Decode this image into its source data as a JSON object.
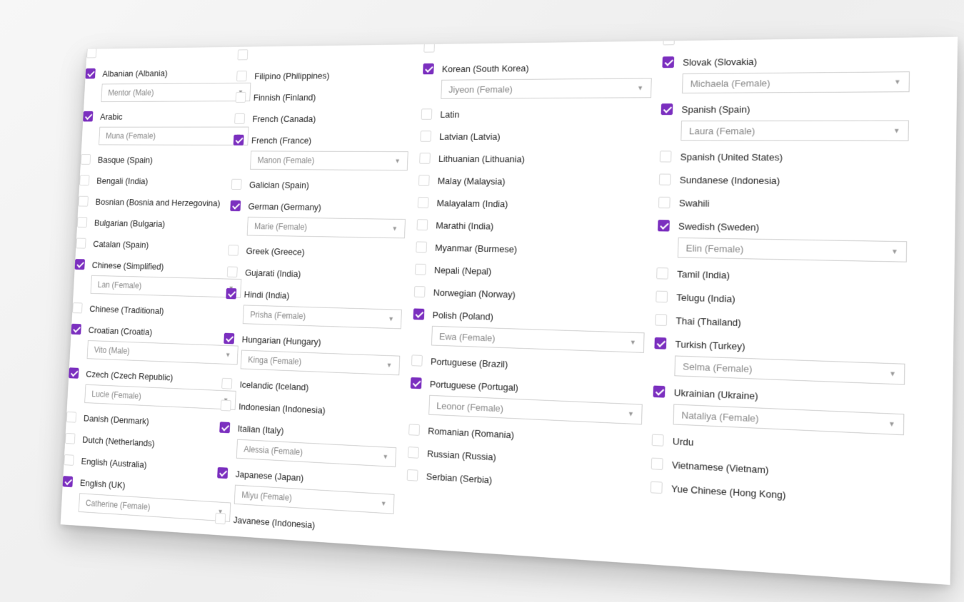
{
  "columns": [
    {
      "items": [
        {
          "label": "",
          "checked": false
        },
        {
          "label": "Albanian (Albania)",
          "checked": true,
          "voice": "Mentor (Male)"
        },
        {
          "label": "Arabic",
          "checked": true,
          "voice": "Muna (Female)"
        },
        {
          "label": "Basque (Spain)",
          "checked": false
        },
        {
          "label": "Bengali (India)",
          "checked": false
        },
        {
          "label": "Bosnian (Bosnia and Herzegovina)",
          "checked": false
        },
        {
          "label": "Bulgarian (Bulgaria)",
          "checked": false
        },
        {
          "label": "Catalan (Spain)",
          "checked": false
        },
        {
          "label": "Chinese (Simplified)",
          "checked": true,
          "voice": "Lan (Female)"
        },
        {
          "label": "Chinese (Traditional)",
          "checked": false
        },
        {
          "label": "Croatian (Croatia)",
          "checked": true,
          "voice": "Vito (Male)"
        },
        {
          "label": "Czech (Czech Republic)",
          "checked": true,
          "voice": "Lucie (Female)"
        },
        {
          "label": "Danish (Denmark)",
          "checked": false
        },
        {
          "label": "Dutch (Netherlands)",
          "checked": false
        },
        {
          "label": "English (Australia)",
          "checked": false
        },
        {
          "label": "English (UK)",
          "checked": true,
          "voice": "Catherine (Female)"
        }
      ]
    },
    {
      "items": [
        {
          "label": "",
          "checked": false
        },
        {
          "label": "Filipino (Philippines)",
          "checked": false
        },
        {
          "label": "Finnish (Finland)",
          "checked": false
        },
        {
          "label": "French (Canada)",
          "checked": false
        },
        {
          "label": "French (France)",
          "checked": true,
          "voice": "Manon (Female)"
        },
        {
          "label": "Galician (Spain)",
          "checked": false
        },
        {
          "label": "German (Germany)",
          "checked": true,
          "voice": "Marie (Female)"
        },
        {
          "label": "Greek (Greece)",
          "checked": false
        },
        {
          "label": "Gujarati (India)",
          "checked": false
        },
        {
          "label": "Hindi (India)",
          "checked": true,
          "voice": "Prisha (Female)"
        },
        {
          "label": "Hungarian (Hungary)",
          "checked": true,
          "voice": "Kinga (Female)"
        },
        {
          "label": "Icelandic (Iceland)",
          "checked": false
        },
        {
          "label": "Indonesian (Indonesia)",
          "checked": false
        },
        {
          "label": "Italian (Italy)",
          "checked": true,
          "voice": "Alessia (Female)"
        },
        {
          "label": "Japanese (Japan)",
          "checked": true,
          "voice": "Miyu (Female)"
        },
        {
          "label": "Javanese (Indonesia)",
          "checked": false
        }
      ]
    },
    {
      "items": [
        {
          "label": "",
          "checked": false
        },
        {
          "label": "Korean (South Korea)",
          "checked": true,
          "voice": "Jiyeon (Female)"
        },
        {
          "label": "Latin",
          "checked": false
        },
        {
          "label": "Latvian (Latvia)",
          "checked": false
        },
        {
          "label": "Lithuanian (Lithuania)",
          "checked": false
        },
        {
          "label": "Malay (Malaysia)",
          "checked": false
        },
        {
          "label": "Malayalam (India)",
          "checked": false
        },
        {
          "label": "Marathi (India)",
          "checked": false
        },
        {
          "label": "Myanmar (Burmese)",
          "checked": false
        },
        {
          "label": "Nepali (Nepal)",
          "checked": false
        },
        {
          "label": "Norwegian (Norway)",
          "checked": false
        },
        {
          "label": "Polish (Poland)",
          "checked": true,
          "voice": "Ewa (Female)"
        },
        {
          "label": "Portuguese (Brazil)",
          "checked": false
        },
        {
          "label": "Portuguese (Portugal)",
          "checked": true,
          "voice": "Leonor (Female)"
        },
        {
          "label": "Romanian (Romania)",
          "checked": false
        },
        {
          "label": "Russian (Russia)",
          "checked": false
        },
        {
          "label": "Serbian (Serbia)",
          "checked": false
        }
      ]
    },
    {
      "items": [
        {
          "label": "",
          "checked": false
        },
        {
          "label": "Slovak (Slovakia)",
          "checked": true,
          "voice": "Michaela (Female)"
        },
        {
          "label": "Spanish (Spain)",
          "checked": true,
          "voice": "Laura (Female)"
        },
        {
          "label": "Spanish (United States)",
          "checked": false
        },
        {
          "label": "Sundanese (Indonesia)",
          "checked": false
        },
        {
          "label": "Swahili",
          "checked": false
        },
        {
          "label": "Swedish (Sweden)",
          "checked": true,
          "voice": "Elin (Female)"
        },
        {
          "label": "Tamil (India)",
          "checked": false
        },
        {
          "label": "Telugu (India)",
          "checked": false
        },
        {
          "label": "Thai (Thailand)",
          "checked": false
        },
        {
          "label": "Turkish (Turkey)",
          "checked": true,
          "voice": "Selma (Female)"
        },
        {
          "label": "Ukrainian (Ukraine)",
          "checked": true,
          "voice": "Nataliya (Female)"
        },
        {
          "label": "Urdu",
          "checked": false
        },
        {
          "label": "Vietnamese (Vietnam)",
          "checked": false
        },
        {
          "label": "Yue Chinese (Hong Kong)",
          "checked": false
        }
      ]
    }
  ],
  "colors": {
    "accent": "#7b2fbf",
    "border": "#cfcfcf"
  },
  "icons": {
    "dropdown": "chevron-down-icon",
    "check": "checkmark-icon"
  }
}
